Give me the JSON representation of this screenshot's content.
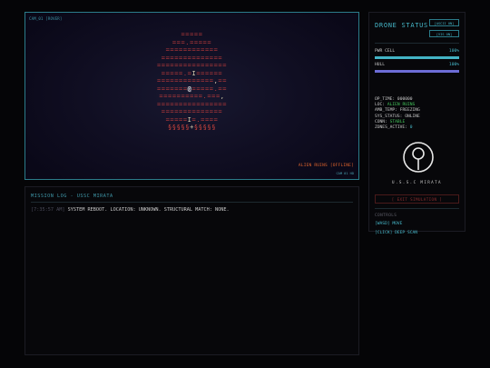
{
  "viewport": {
    "cam_label": "CAM_01 [ROVER]",
    "location_status": "ALIEN RUINS [OFFLINE]",
    "frame_label": "CAM 01 HD",
    "map_rows": [
      "=====",
      "===.=====",
      "============",
      "==============",
      "================",
      "=====.=I======",
      "=============,==",
      "=======@=====.==",
      "==========.===,",
      "================",
      "==============",
      "=====I=.====",
      "§§§§§+§§§§§"
    ]
  },
  "log": {
    "title": "MISSION LOG - USSC MIRATA",
    "entries": [
      {
        "timestamp": "[7:35:57 AM]",
        "message": "SYSTEM REBOOT. LOCATION: UNKNOWN. STRUCTURAL MATCH: NONE."
      }
    ]
  },
  "status": {
    "title": "DRONE STATUS",
    "btn_ai": "[ASCII ON]",
    "btn_res": "[VIS ON]",
    "pwr_label": "PWR CELL",
    "pwr_value": "100%",
    "pwr_level": 1.0,
    "hull_label": "HULL",
    "hull_value": "100%",
    "hull_level": 1.0,
    "op_time_label": "OP_TIME:",
    "op_time": "000000",
    "loc_label": "LOC:",
    "loc": "ALIEN RUINS",
    "amb_label": "AMB_TEMP:",
    "amb": "FREEZING",
    "sys_label": "SYS_STATUS:",
    "sys": "ONLINE",
    "conn_label": "CONN:",
    "conn": "STABLE",
    "zones_label": "ZONES_ACTIVE:",
    "zones": "0",
    "ship_name": "U.S.S.C MIRATA",
    "exit_label": "[ EXIT SIMULATION ]",
    "controls_title": "CONTROLS",
    "ctl_move": "[WASD] MOVE",
    "ctl_scan": "[CLICK] DEEP SCAN",
    "colors": {
      "accent": "#46b7c8",
      "power": "#43b3c4",
      "hull": "#6c6cd6",
      "danger": "#8e2f2f",
      "map": "#b93a3a"
    }
  }
}
